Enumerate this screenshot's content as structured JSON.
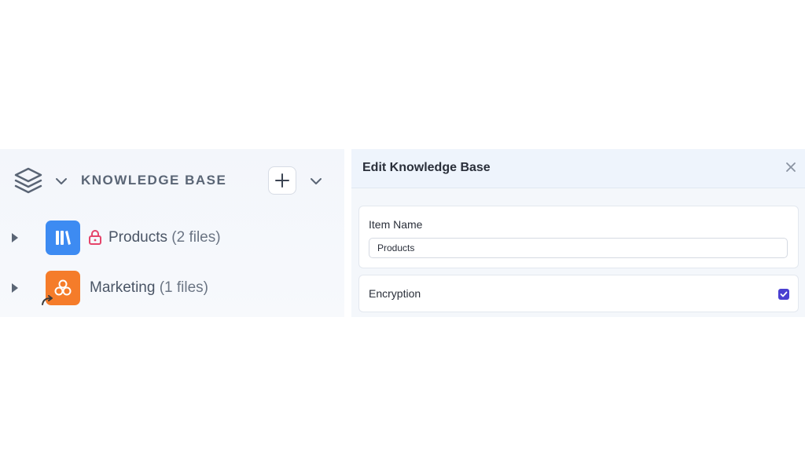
{
  "knowledge_base": {
    "title": "KNOWLEDGE BASE",
    "items": [
      {
        "name": "Products",
        "count": "(2 files)",
        "locked": true,
        "icon": "books-icon",
        "color": "#3d8bf2"
      },
      {
        "name": "Marketing",
        "count": "(1 files)",
        "locked": false,
        "shared": true,
        "icon": "cubes-icon",
        "color": "#f57c2a"
      }
    ]
  },
  "edit_panel": {
    "title": "Edit Knowledge Base",
    "item_name_label": "Item Name",
    "item_name_value": "Products",
    "encryption_label": "Encryption",
    "encryption_checked": true,
    "accent": "#4a3fd1"
  }
}
